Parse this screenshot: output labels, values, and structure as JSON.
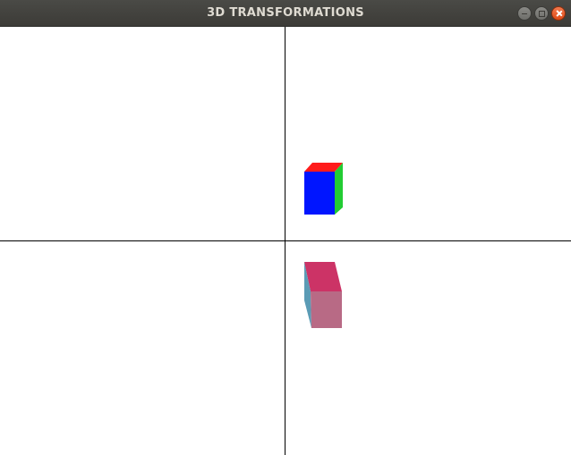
{
  "window": {
    "title": "3D TRANSFORMATIONS"
  },
  "titlebar_buttons": [
    "minimize",
    "maximize",
    "close"
  ],
  "colors": {
    "titlebar": "#3c3b37",
    "axes": "#000000",
    "cube_original_top": "#ff1b1b",
    "cube_original_front": "#0015ff",
    "cube_original_side": "#22cc33",
    "cube_transformed_top": "#cc3366",
    "cube_transformed_front": "#b86a85",
    "cube_transformed_side": "#5b9bb5"
  }
}
